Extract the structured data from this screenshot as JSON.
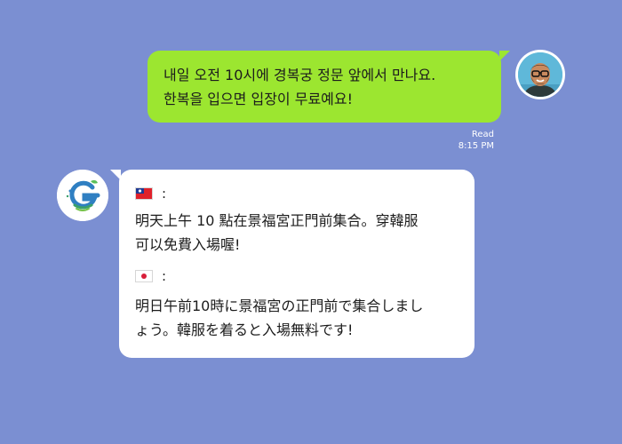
{
  "outgoing_message": {
    "lines": [
      "내일 오전 10시에 경복궁 정문 앞에서 만나요.",
      "한복을 입으면 입장이 무료예요!"
    ],
    "status": "Read",
    "time": "8:15 PM",
    "bubble_color": "#9ce630"
  },
  "incoming_message": {
    "translations": [
      {
        "flag_icon": "taiwan-flag-icon",
        "separator": ":",
        "lines": [
          "明天上午 10 點在景福宮正門前集合。穿韓服",
          "可以免費入場喔!"
        ]
      },
      {
        "flag_icon": "japan-flag-icon",
        "separator": ":",
        "lines": [
          "明日午前10時に景福宮の正門前で集合しまし",
          "ょう。韓服を着ると入場無料です!"
        ]
      }
    ]
  },
  "colors": {
    "background": "#7b8fd2",
    "incoming_bubble": "#ffffff",
    "text": "#1c1c1c"
  }
}
